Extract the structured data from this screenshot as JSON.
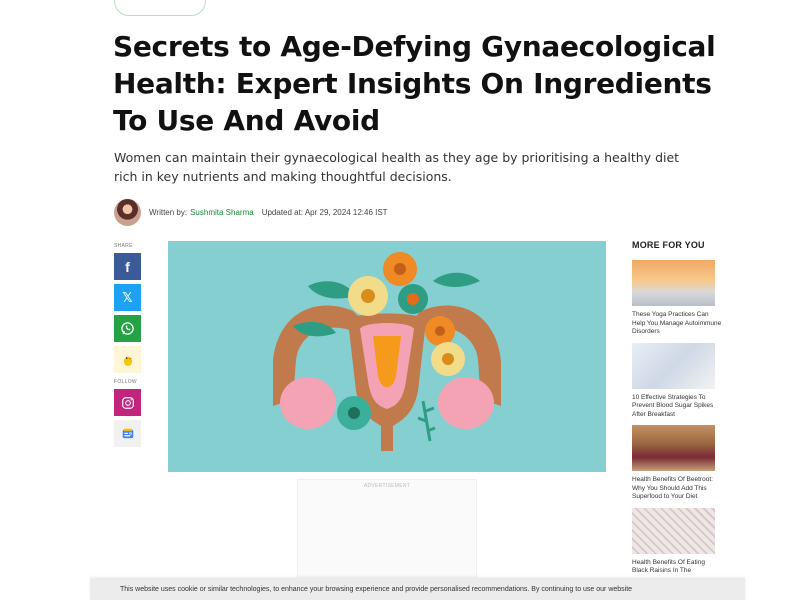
{
  "article": {
    "title": "Secrets to Age-Defying Gynaecological Health: Expert Insights On Ingredients To Use And Avoid",
    "summary": "Women can maintain their gynaecological health as they age by prioritising a healthy diet rich in key nutrients and making thoughtful decisions.",
    "byline": {
      "written_by_label": "Written by:",
      "author": "Sushmita Sharma",
      "updated": "Updated at: Apr 29, 2024 12:46 IST"
    },
    "hero_image_alt": "Paper craft illustration of a uterus decorated with colourful flowers and leaves"
  },
  "share": {
    "label": "SHARE",
    "items": [
      {
        "name": "facebook",
        "icon": "facebook-icon",
        "glyph": "f"
      },
      {
        "name": "x",
        "icon": "x-icon",
        "glyph": "𝕏"
      },
      {
        "name": "whatsapp",
        "icon": "whatsapp-icon"
      },
      {
        "name": "koo",
        "icon": "koo-icon"
      }
    ]
  },
  "follow": {
    "label": "FOLLOW",
    "items": [
      {
        "name": "instagram",
        "icon": "instagram-icon"
      },
      {
        "name": "google-news",
        "icon": "google-news-icon"
      }
    ]
  },
  "advertisement": {
    "label": "ADVERTISEMENT"
  },
  "more_for_you": {
    "title": "MORE FOR YOU",
    "items": [
      {
        "title": "These Yoga Practices Can Help You Manage Autoimmune Disorders"
      },
      {
        "title": "10 Effective Strategies To Prevent Blood Sugar Spikes After Breakfast"
      },
      {
        "title": "Health Benefits Of Beetroot: Why You Should Add This Superfood to Your Diet"
      },
      {
        "title": "Health Benefits Of Eating Black Raisins In The"
      }
    ]
  },
  "cookie_notice": {
    "text": "This website uses cookie or similar technologies, to enhance your browsing experience and provide personalised recommendations. By continuing to use our website"
  },
  "colors": {
    "author": "#1a8a3a",
    "facebook": "#3a5a98",
    "x": "#1da1f2",
    "whatsapp": "#25a244",
    "instagram": "#c1247c",
    "hero_bg": "#86cfd1"
  }
}
